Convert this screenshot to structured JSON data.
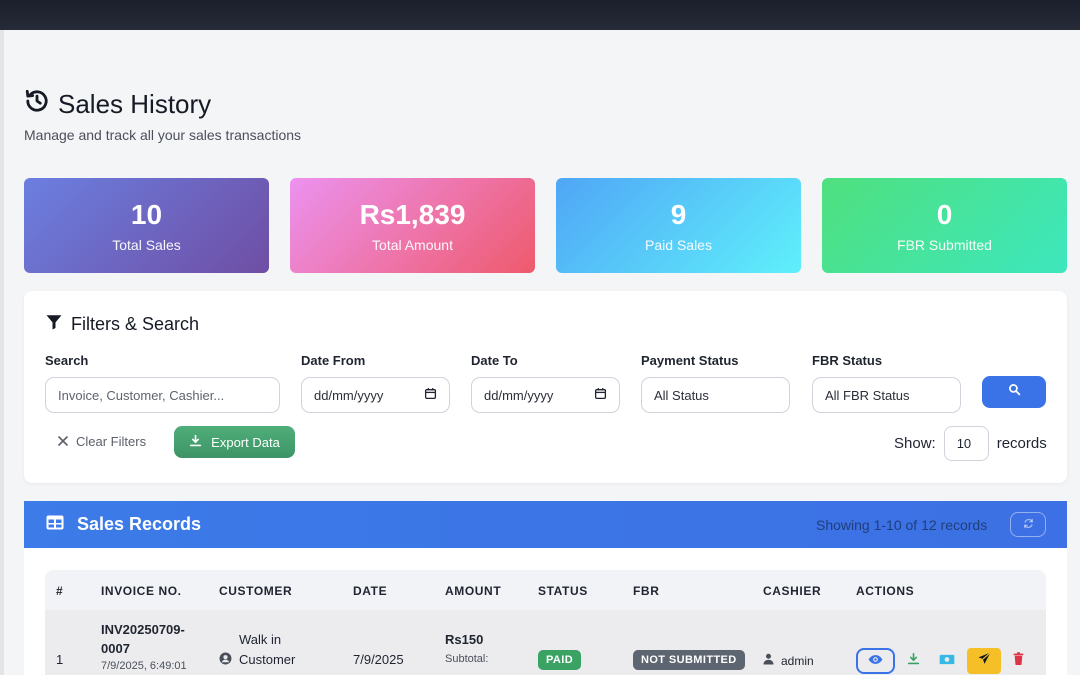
{
  "header": {
    "title": "Sales History",
    "subtitle": "Manage and track all your sales transactions"
  },
  "stats": [
    {
      "value": "10",
      "label": "Total Sales"
    },
    {
      "value": "Rs1,839",
      "label": "Total Amount"
    },
    {
      "value": "9",
      "label": "Paid Sales"
    },
    {
      "value": "0",
      "label": "FBR Submitted"
    }
  ],
  "filters": {
    "title": "Filters & Search",
    "search_label": "Search",
    "search_placeholder": "Invoice, Customer, Cashier...",
    "date_from_label": "Date From",
    "date_from_value": "dd/mm/yyyy",
    "date_to_label": "Date To",
    "date_to_value": "dd/mm/yyyy",
    "payment_label": "Payment Status",
    "payment_value": "All Status",
    "fbr_label": "FBR Status",
    "fbr_value": "All FBR Status",
    "clear_label": "Clear Filters",
    "export_label": "Export Data",
    "show_label": "Show:",
    "show_value": "10",
    "records_label": "records"
  },
  "records": {
    "title": "Sales Records",
    "count_text": "Showing 1-10 of 12 records",
    "columns": [
      "#",
      "INVOICE NO.",
      "CUSTOMER",
      "DATE",
      "AMOUNT",
      "STATUS",
      "FBR",
      "CASHIER",
      "ACTIONS"
    ],
    "rows": [
      {
        "index": "1",
        "invoice_line1": "INV20250709-",
        "invoice_line2": "0007",
        "invoice_datetime": "7/9/2025, 6:49:01",
        "customer_line1": "Walk in",
        "customer_line2": "Customer",
        "date": "7/9/2025",
        "amount": "Rs150",
        "subtotal_label": "Subtotal:",
        "status": "PAID",
        "fbr": "NOT SUBMITTED",
        "cashier": "admin"
      }
    ]
  },
  "colors": {
    "primary": "#3a73e8",
    "success": "#3aa363",
    "warning": "#f5c027",
    "danger": "#dc3545"
  }
}
